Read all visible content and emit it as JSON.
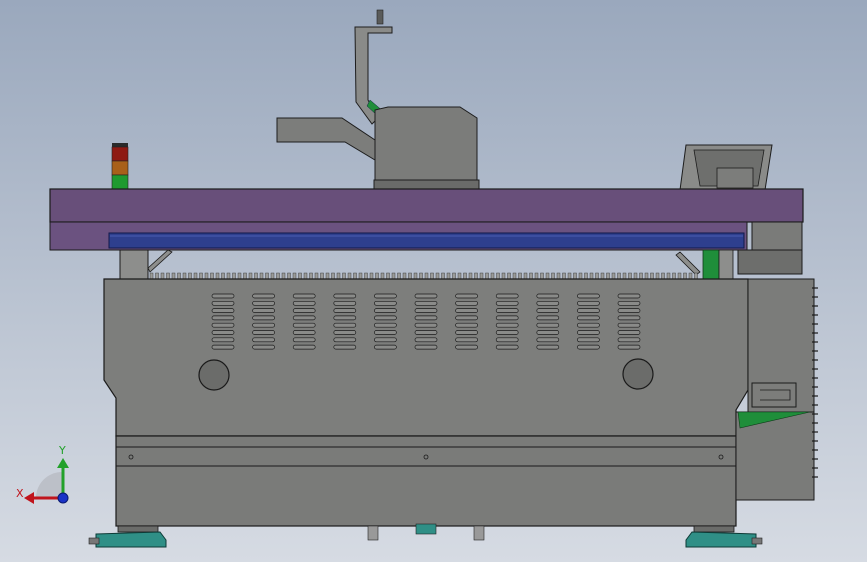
{
  "viewport": {
    "background_top": "#9aa8bd",
    "background_bottom": "#d6dbe3"
  },
  "colors": {
    "body_gray": "#7c7d7b",
    "body_dark": "#5a5b5a",
    "table_purple": "#6b4f78",
    "rail_blue": "#2e3f8e",
    "accent_green": "#1f8e3a",
    "foot_teal": "#2f8f86",
    "axis_red": "#c0141c",
    "axis_green": "#22a12a",
    "axis_blue": "#1a33c7"
  },
  "axes": {
    "x_label": "X",
    "y_label": "Y"
  },
  "parts": {
    "signal_tower": [
      "red",
      "amber",
      "green"
    ],
    "vent_rows": 8,
    "vent_columns": 11
  }
}
